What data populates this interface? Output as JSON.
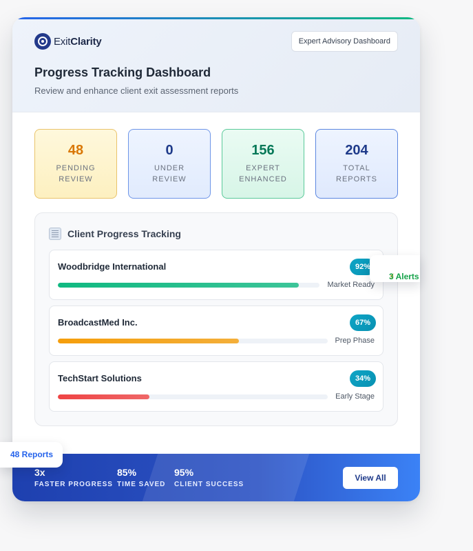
{
  "brand": {
    "name_light": "Exit",
    "name_bold": "Clarity"
  },
  "header": {
    "badge": "Expert Advisory Dashboard",
    "title": "Progress Tracking Dashboard",
    "subtitle": "Review and enhance client exit assessment reports"
  },
  "stats": [
    {
      "value": "48",
      "label_line1": "PENDING",
      "label_line2": "REVIEW"
    },
    {
      "value": "0",
      "label_line1": "UNDER",
      "label_line2": "REVIEW"
    },
    {
      "value": "156",
      "label_line1": "EXPERT",
      "label_line2": "ENHANCED"
    },
    {
      "value": "204",
      "label_line1": "TOTAL",
      "label_line2": "REPORTS"
    }
  ],
  "tracking": {
    "title": "Client Progress Tracking",
    "clients": [
      {
        "name": "Woodbridge International",
        "percent_label": "92%",
        "progress": 0.92,
        "stage": "Market Ready",
        "color": "#10b981"
      },
      {
        "name": "BroadcastMed Inc.",
        "percent_label": "67%",
        "progress": 0.67,
        "stage": "Prep Phase",
        "color": "#f59e0b"
      },
      {
        "name": "TechStart Solutions",
        "percent_label": "34%",
        "progress": 0.34,
        "stage": "Early Stage",
        "color": "#ef4444"
      }
    ]
  },
  "footer": {
    "metrics": [
      {
        "value": "3x",
        "label": "FASTER PROGRESS"
      },
      {
        "value": "85%",
        "label": "TIME SAVED"
      },
      {
        "value": "95%",
        "label": "CLIENT SUCCESS"
      }
    ],
    "view_all": "View All"
  },
  "floating": {
    "reports": "48 Reports",
    "alerts": "3 Alerts",
    "alerts_icon": "lightning-icon"
  }
}
